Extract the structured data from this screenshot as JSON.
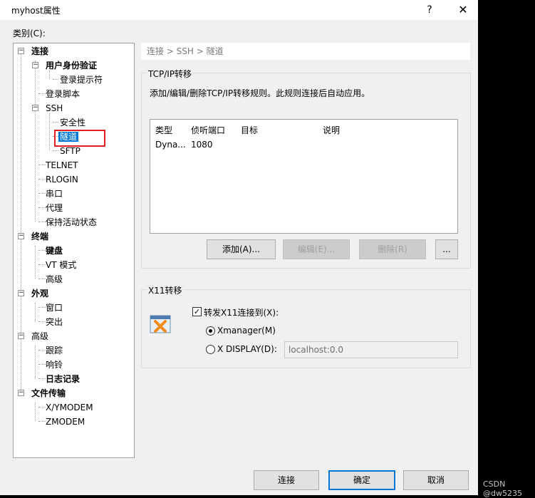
{
  "window": {
    "title": "myhost属性",
    "help": "?",
    "close": "✕"
  },
  "category_label": "类别(C):",
  "tree": {
    "items": [
      {
        "label": "连接",
        "bold": true
      },
      {
        "label": "用户身份验证",
        "bold": true
      },
      {
        "label": "登录提示符"
      },
      {
        "label": "登录脚本"
      },
      {
        "label": "SSH"
      },
      {
        "label": "安全性"
      },
      {
        "label": "隧道",
        "selected": true
      },
      {
        "label": "SFTP"
      },
      {
        "label": "TELNET"
      },
      {
        "label": "RLOGIN"
      },
      {
        "label": "串口"
      },
      {
        "label": "代理"
      },
      {
        "label": "保持活动状态"
      },
      {
        "label": "终端",
        "bold": true
      },
      {
        "label": "键盘",
        "bold": true
      },
      {
        "label": "VT 模式"
      },
      {
        "label": "高级"
      },
      {
        "label": "外观",
        "bold": true
      },
      {
        "label": "窗口"
      },
      {
        "label": "突出"
      },
      {
        "label": "高级"
      },
      {
        "label": "跟踪"
      },
      {
        "label": "响铃"
      },
      {
        "label": "日志记录",
        "bold": true
      },
      {
        "label": "文件传输",
        "bold": true
      },
      {
        "label": "X/YMODEM"
      },
      {
        "label": "ZMODEM"
      }
    ]
  },
  "breadcrumb": "连接 > SSH > 隧道",
  "tcp": {
    "title": "TCP/IP转移",
    "description": "添加/编辑/删除TCP/IP转移规则。此规则连接后自动应用。",
    "columns": [
      "类型",
      "侦听端口",
      "目标",
      "说明"
    ],
    "rows": [
      [
        "Dyna...",
        "1080",
        "",
        ""
      ]
    ],
    "buttons": {
      "add": "添加(A)...",
      "edit": "编辑(E)...",
      "delete": "删除(R)",
      "more": "..."
    }
  },
  "x11": {
    "title": "X11转移",
    "forward_label": "转发X11连接到(X):",
    "forward_checked": true,
    "xmanager_label": "Xmanager(M)",
    "xdisplay_label": "X DISPLAY(D):",
    "xdisplay_value": "localhost:0.0",
    "selected": "xmanager"
  },
  "footer": {
    "connect": "连接",
    "ok": "确定",
    "cancel": "取消"
  },
  "watermark": "CSDN @dw5235",
  "colors": {
    "accent": "#0078d7",
    "highlight_box": "#e02020"
  }
}
